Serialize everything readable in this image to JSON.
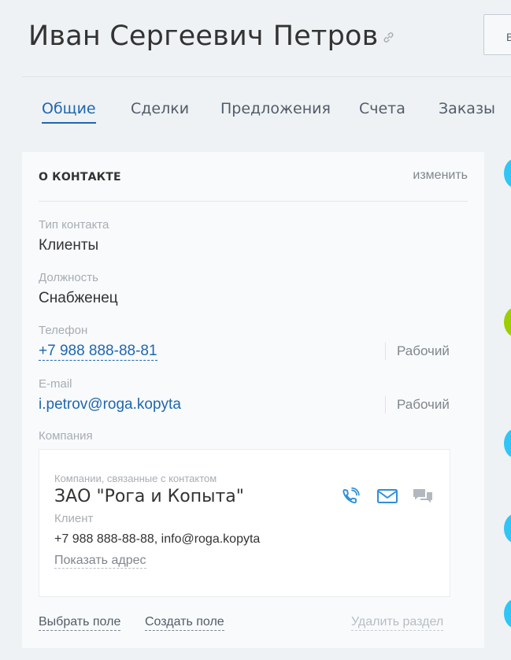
{
  "header": {
    "first_name": "Иван",
    "middle_name": "Сергеевич",
    "last_name": "Петров",
    "top_button_label": "В"
  },
  "tabs": [
    {
      "label": "Общие",
      "active": true
    },
    {
      "label": "Сделки",
      "active": false
    },
    {
      "label": "Предложения",
      "active": false
    },
    {
      "label": "Счета",
      "active": false
    },
    {
      "label": "Заказы",
      "active": false
    }
  ],
  "card": {
    "title": "О КОНТАКТЕ",
    "edit_label": "изменить",
    "fields": {
      "contact_type": {
        "label": "Тип контакта",
        "value": "Клиенты"
      },
      "position": {
        "label": "Должность",
        "value": "Снабженец"
      },
      "phone": {
        "label": "Телефон",
        "value": "+7 988 888-88-81",
        "type": "Рабочий"
      },
      "email": {
        "label": "E-mail",
        "value": "i.petrov@roga.kopyta",
        "type": "Рабочий"
      },
      "company": {
        "label": "Компания"
      }
    },
    "company_block": {
      "caption": "Компании, связанные с контактом",
      "name": "ЗАО \"Рога и Копыта\"",
      "status": "Клиент",
      "contacts": "+7 988 888-88-88, info@roga.kopyta",
      "show_address": "Показать адрес",
      "icons": [
        "phone-icon",
        "mail-icon",
        "chat-icon"
      ]
    },
    "footer": {
      "select_field": "Выбрать поле",
      "create_field": "Создать поле",
      "delete_section": "Удалить раздел"
    }
  },
  "colors": {
    "accent": "#2067b0",
    "icon_blue": "#2f8fd8",
    "timeline_blue": "#2fc6f6",
    "timeline_green": "#9dcf00"
  }
}
